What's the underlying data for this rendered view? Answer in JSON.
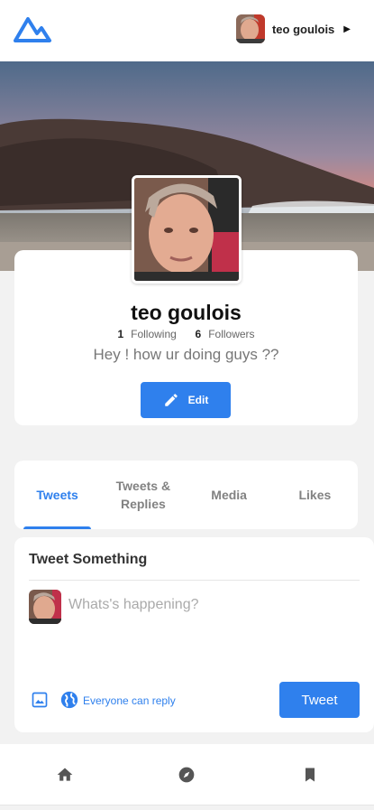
{
  "header": {
    "user_name": "teo goulois"
  },
  "profile": {
    "name": "teo goulois",
    "following_count": "1",
    "following_label": "Following",
    "followers_count": "6",
    "followers_label": "Followers",
    "bio": "Hey ! how ur doing guys ??",
    "edit_label": "Edit"
  },
  "tabs": [
    {
      "label": "Tweets",
      "active": true
    },
    {
      "label": "Tweets & Replies",
      "active": false
    },
    {
      "label": "Media",
      "active": false
    },
    {
      "label": "Likes",
      "active": false
    }
  ],
  "compose": {
    "title": "Tweet Something",
    "placeholder": "Whats's happening?",
    "reply_setting": "Everyone can reply",
    "tweet_label": "Tweet"
  },
  "bottom_nav": [
    "home-icon",
    "explore-icon",
    "bookmark-icon"
  ],
  "colors": {
    "accent": "#2f80ed"
  }
}
